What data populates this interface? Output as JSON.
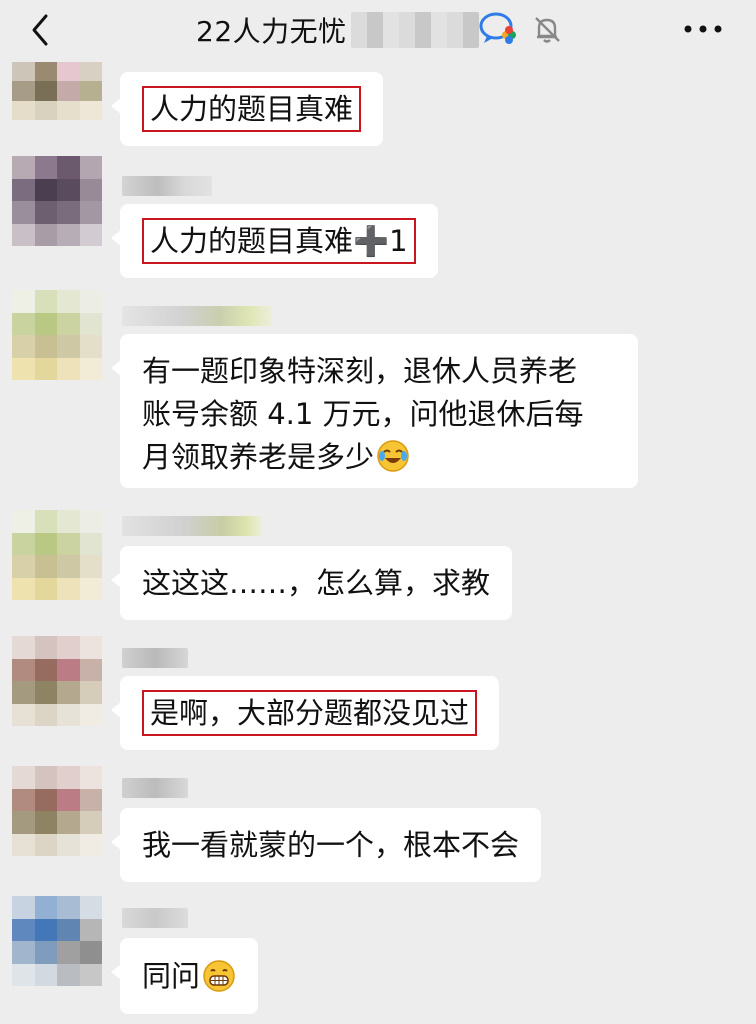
{
  "header": {
    "title": "22人力无忧",
    "back_icon": "chevron-left-icon",
    "app_icon": "wecom-icon",
    "mute_icon": "bell-off-icon",
    "more_icon": "more-dots-icon"
  },
  "messages": [
    {
      "text": "人力的题目真难",
      "highlighted": true
    },
    {
      "text": "人力的题目真难➕1",
      "highlighted": true
    },
    {
      "lines": [
        "有一题印象特深刻，退休人员养老",
        "账号余额 4.1 万元，问他退休后每",
        "月领取养老是多少"
      ],
      "emoji": "tears-of-joy-emoji",
      "highlighted": false
    },
    {
      "text": "这这这……，怎么算，求教",
      "highlighted": false
    },
    {
      "text": "是啊，大部分题都没见过",
      "highlighted": true
    },
    {
      "text": "我一看就蒙的一个，根本不会",
      "highlighted": false
    },
    {
      "text": "同问",
      "emoji": "grinning-emoji",
      "highlighted": false
    }
  ],
  "colors": {
    "background": "#ededed",
    "bubble": "#ffffff",
    "highlight_border": "#c9151e"
  }
}
